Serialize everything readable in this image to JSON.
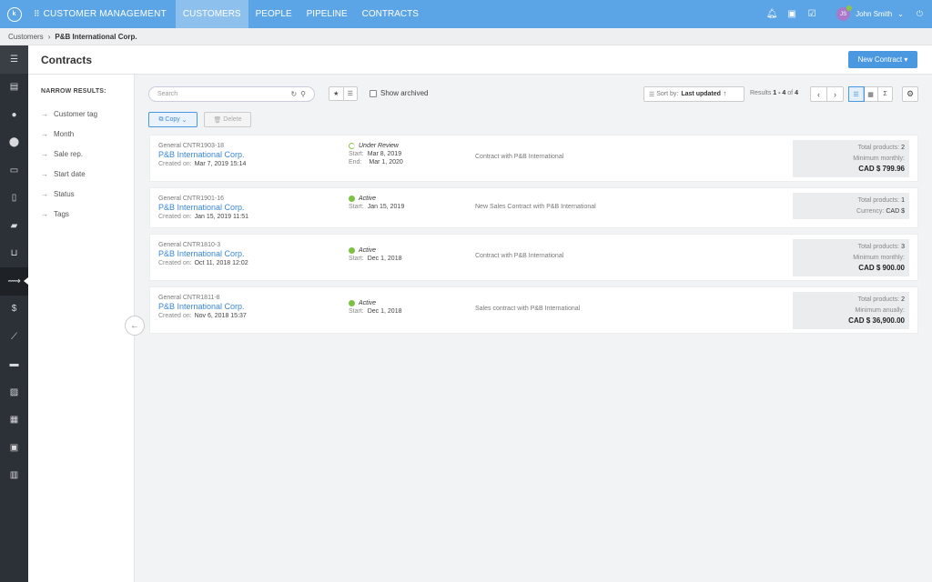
{
  "topbar": {
    "app_title": "CUSTOMER MANAGEMENT",
    "tabs": [
      {
        "label": "CUSTOMERS",
        "active": true
      },
      {
        "label": "PEOPLE",
        "active": false
      },
      {
        "label": "PIPELINE",
        "active": false
      },
      {
        "label": "CONTRACTS",
        "active": false
      }
    ],
    "user_name": "John Smith",
    "avatar_initials": "JS",
    "accent_color": "#5ba4e6"
  },
  "breadcrumb": {
    "root": "Customers",
    "current": "P&B International Corp."
  },
  "header": {
    "title": "Contracts",
    "new_button": "New Contract"
  },
  "narrow": {
    "title": "NARROW RESULTS:",
    "items": [
      "Customer tag",
      "Month",
      "Sale rep.",
      "Start date",
      "Status",
      "Tags"
    ]
  },
  "toolbar": {
    "search_placeholder": "Search",
    "show_archived": "Show archived",
    "sort_label": "Sort by:",
    "sort_value": "Last updated",
    "results_prefix": "Results",
    "results_range": "1 - 4",
    "results_of": "of",
    "results_total": "4",
    "copy_label": "Copy",
    "delete_label": "Delete"
  },
  "contracts": [
    {
      "number": "General CNTR1903-18",
      "customer": "P&B International Corp.",
      "created_label": "Created on:",
      "created": "Mar 7, 2019 15:14",
      "status": "Under Review",
      "status_color": "#8bc34a",
      "start_label": "Start:",
      "start": "Mar 8, 2019",
      "end_label": "End:",
      "end": "Mar 1, 2020",
      "description": "Contract with P&B International",
      "sum_lines": [
        {
          "label": "Total products:",
          "value": "2"
        },
        {
          "label": "Minimum monthly:",
          "value": ""
        }
      ],
      "amount": "CAD $ 799.96"
    },
    {
      "number": "General CNTR1901-16",
      "customer": "P&B International Corp.",
      "created_label": "Created on:",
      "created": "Jan 15, 2019 11:51",
      "status": "Active",
      "status_color": "#7cc242",
      "start_label": "Start:",
      "start": "Jan 15, 2019",
      "description": "New Sales Contract with P&B International",
      "sum_lines": [
        {
          "label": "Total products:",
          "value": "1"
        },
        {
          "label": "Currency:",
          "value": "CAD $"
        }
      ],
      "amount": ""
    },
    {
      "number": "General CNTR1810-3",
      "customer": "P&B International Corp.",
      "created_label": "Created on:",
      "created": "Oct 11, 2018 12:02",
      "status": "Active",
      "status_color": "#7cc242",
      "start_label": "Start:",
      "start": "Dec 1, 2018",
      "description": "Contract with P&B International",
      "sum_lines": [
        {
          "label": "Total products:",
          "value": "3"
        },
        {
          "label": "Minimum monthly:",
          "value": ""
        }
      ],
      "amount": "CAD $ 900.00"
    },
    {
      "number": "General CNTR1811-8",
      "customer": "P&B International Corp.",
      "created_label": "Created on:",
      "created": "Nov 6, 2018 15:37",
      "status": "Active",
      "status_color": "#7cc242",
      "start_label": "Start:",
      "start": "Dec 1, 2018",
      "description": "Sales contract with P&B International",
      "sum_lines": [
        {
          "label": "Total products:",
          "value": "2"
        },
        {
          "label": "Minimum anually:",
          "value": ""
        }
      ],
      "amount": "CAD $ 36,900.00"
    }
  ]
}
